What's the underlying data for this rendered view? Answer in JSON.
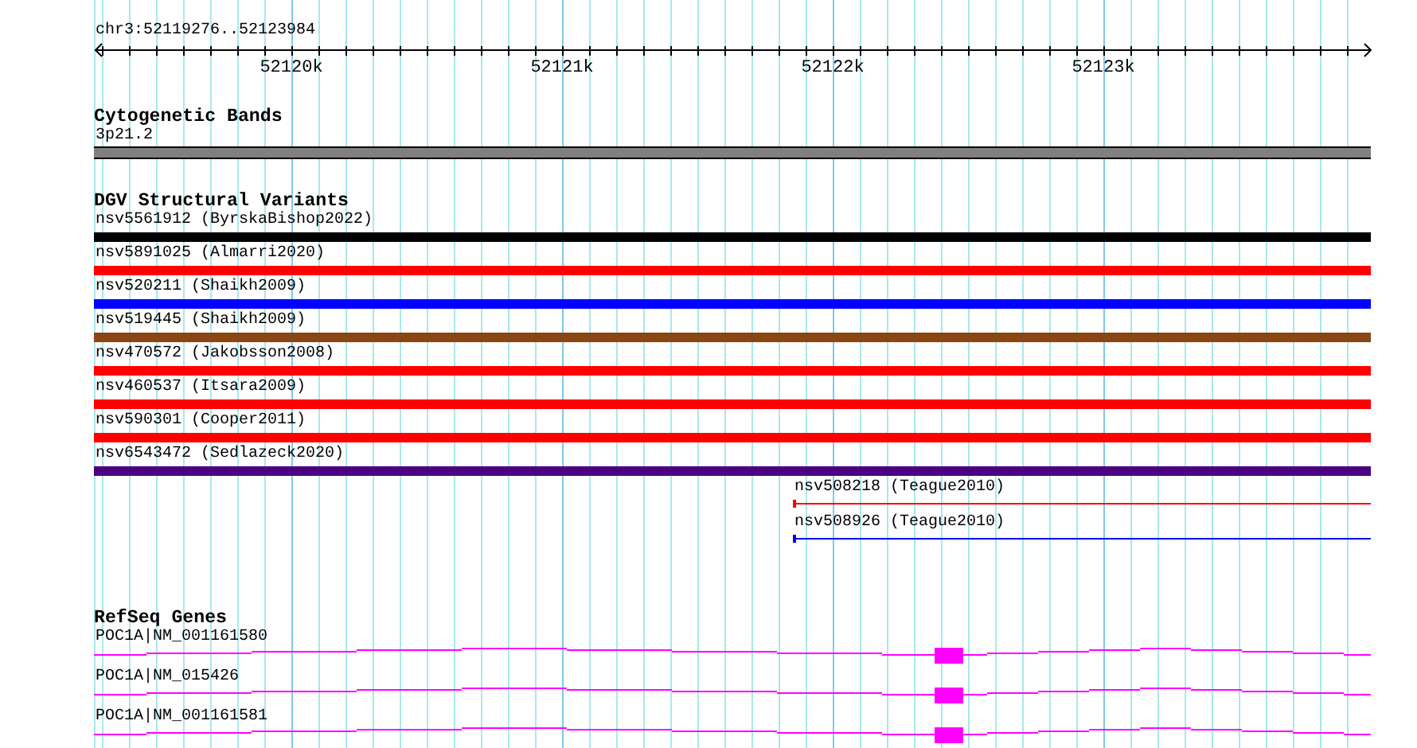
{
  "location": "chr3:52119276..52123984",
  "ruler": {
    "labels": [
      "52120k",
      "52121k",
      "52122k",
      "52123k"
    ]
  },
  "tracks": [
    {
      "kind": "cytoband",
      "title": "Cytogenetic Bands",
      "features": [
        {
          "label": "3p21.2"
        }
      ]
    },
    {
      "kind": "variants",
      "title": "DGV Structural Variants",
      "features": [
        {
          "label": "nsv5561912 (ByrskaBishop2022)",
          "color": "#000000",
          "kind": "thick"
        },
        {
          "label": "nsv5891025 (Almarri2020)",
          "color": "#ff0000",
          "kind": "thick"
        },
        {
          "label": "nsv520211 (Shaikh2009)",
          "color": "#0000ff",
          "kind": "thick"
        },
        {
          "label": "nsv519445 (Shaikh2009)",
          "color": "#8b4513",
          "kind": "thick"
        },
        {
          "label": "nsv470572 (Jakobsson2008)",
          "color": "#ff0000",
          "kind": "thick"
        },
        {
          "label": "nsv460537 (Itsara2009)",
          "color": "#ff0000",
          "kind": "thick"
        },
        {
          "label": "nsv590301 (Cooper2011)",
          "color": "#ff0000",
          "kind": "thick"
        },
        {
          "label": "nsv6543472 (Sedlazeck2020)",
          "color": "#4b0082",
          "kind": "thick"
        },
        {
          "label": "nsv508218 (Teague2010)",
          "color": "#ff0000",
          "kind": "thin"
        },
        {
          "label": "nsv508926 (Teague2010)",
          "color": "#0000ff",
          "kind": "thin"
        }
      ]
    },
    {
      "kind": "genes",
      "title": "RefSeq Genes",
      "features": [
        {
          "label": "POC1A|NM_001161580"
        },
        {
          "label": "POC1A|NM_015426"
        },
        {
          "label": "POC1A|NM_001161581"
        }
      ]
    }
  ]
}
